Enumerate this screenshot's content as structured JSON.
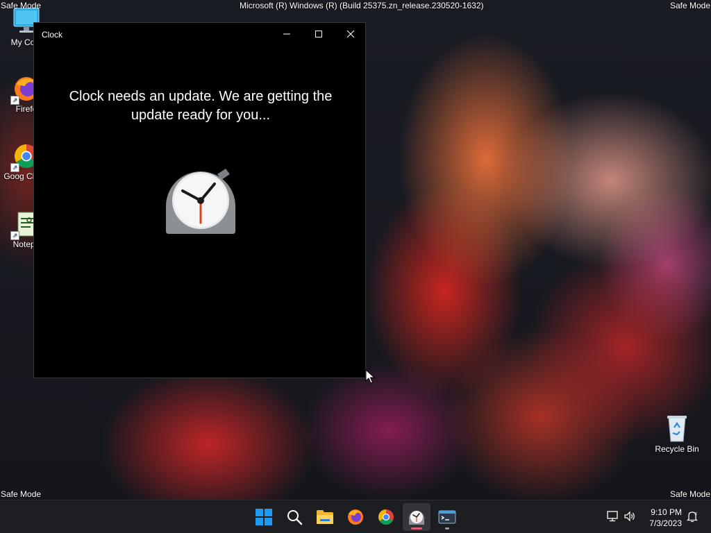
{
  "desktop": {
    "safe_mode_label": "Safe Mode",
    "build_info": "Microsoft (R) Windows (R) (Build 25375.zn_release.230520-1632)",
    "icons": [
      {
        "label": "My Com"
      },
      {
        "label": "Firefo"
      },
      {
        "label": "Goog Chron"
      },
      {
        "label": "Notepa"
      },
      {
        "label": "Recycle Bin"
      }
    ]
  },
  "clock_window": {
    "title": "Clock",
    "message": "Clock needs an update. We are getting the update ready for you..."
  },
  "taskbar": {
    "apps": [
      "windows-start",
      "search",
      "file-explorer",
      "firefox",
      "chrome",
      "clock",
      "terminal"
    ],
    "active_app": "clock",
    "time": "9:10 PM",
    "date": "7/3/2023"
  },
  "colors": {
    "window_bg": "#000000",
    "taskbar_bg": "#1d1e22",
    "start_blue": "#1e9bf0",
    "clock_indicator": "#e06070"
  }
}
